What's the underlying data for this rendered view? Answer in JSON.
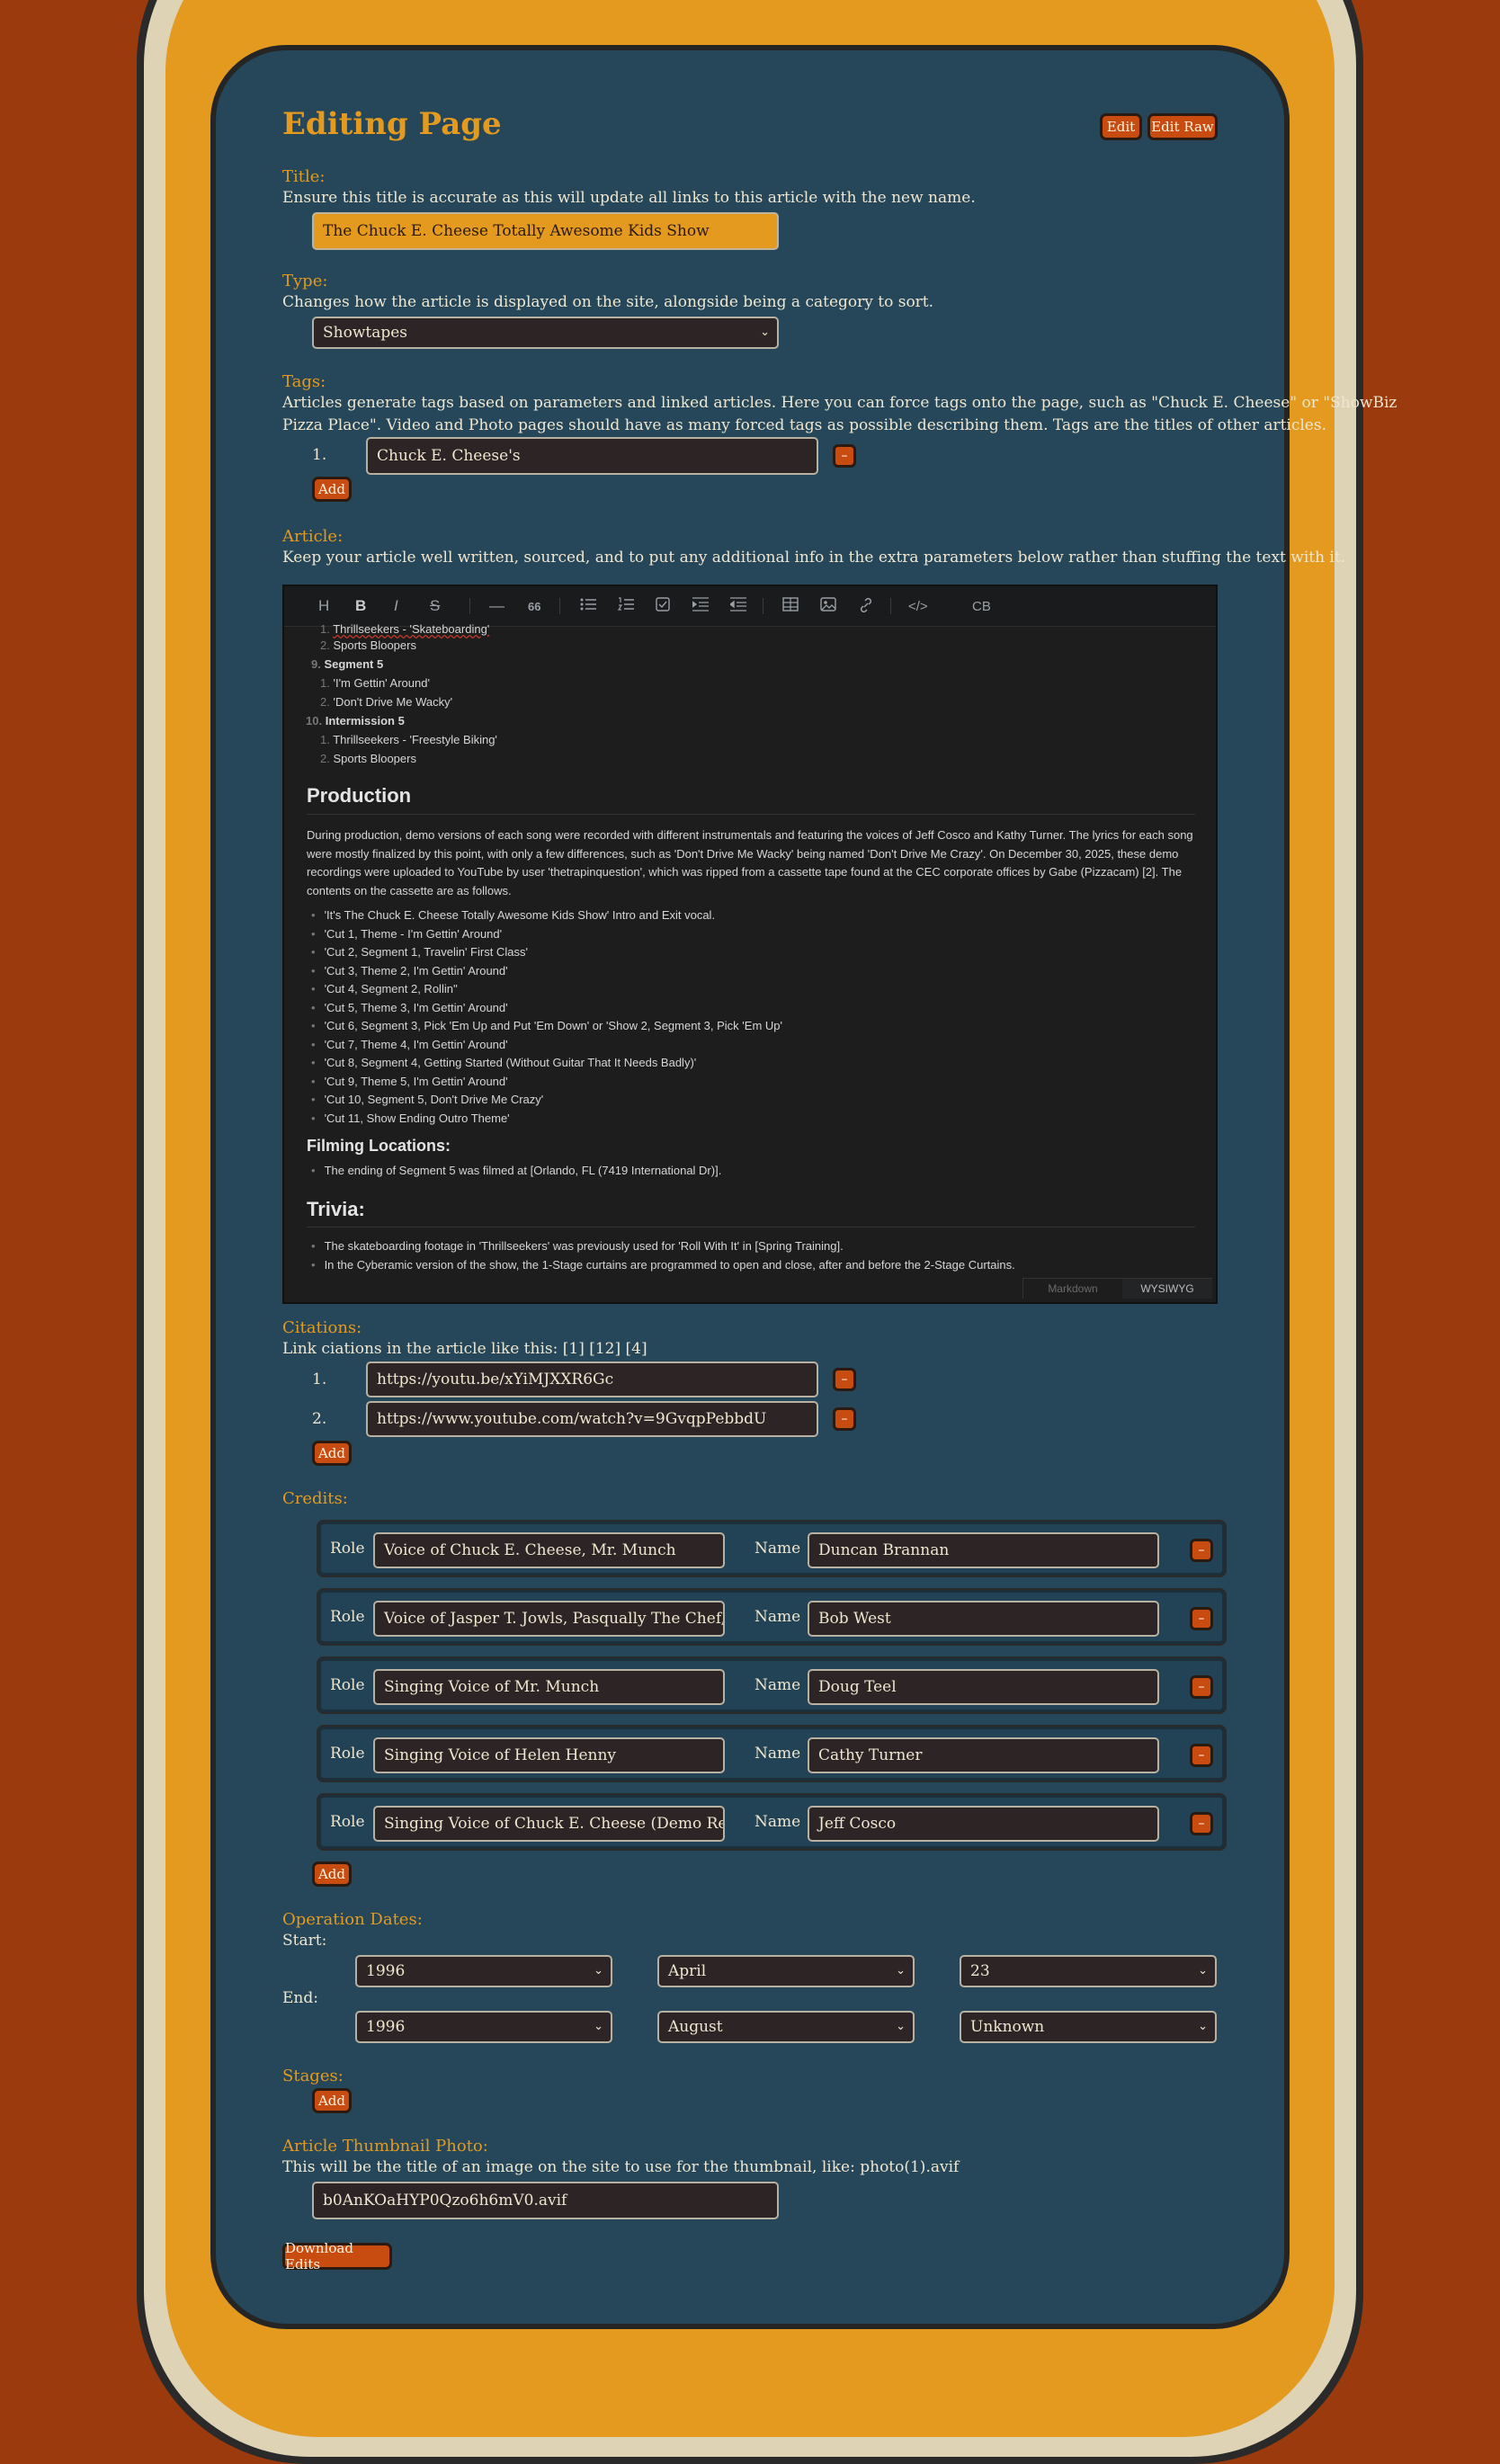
{
  "page": {
    "title": "Editing Page",
    "edit_label": "Edit",
    "edit_raw_label": "Edit Raw"
  },
  "title_field": {
    "label": "Title:",
    "description": "Ensure this title is accurate as this will update all links to this article with the new name.",
    "value": "The Chuck E. Cheese Totally Awesome Kids Show"
  },
  "type_field": {
    "label": "Type:",
    "description": "Changes how the article is displayed on the site, alongside being a category to sort.",
    "value": "Showtapes"
  },
  "tags": {
    "label": "Tags:",
    "description_1": "Articles generate tags based on parameters and linked articles. Here you can force tags onto the page, such as \"Chuck E. Cheese\" or \"ShowBiz",
    "description_2": "Pizza Place\". Video and Photo pages should have as many forced tags as possible describing them. Tags are the titles of other articles.",
    "items": [
      {
        "num": "1.",
        "value": "Chuck E. Cheese's"
      }
    ],
    "add_label": "Add",
    "remove_label": "–"
  },
  "article": {
    "label": "Article:",
    "description": "Keep your article well written, sourced, and to put any additional info in the extra parameters below rather than stuffing the text with it.",
    "toolbar": [
      "heading-icon",
      "bold-icon",
      "italic-icon",
      "strike-icon",
      "hr-icon",
      "quote-icon",
      "bullet-list-icon",
      "ordered-list-icon",
      "task-icon",
      "indent-icon",
      "outdent-icon",
      "table-icon",
      "image-icon",
      "link-icon",
      "code-icon",
      "codeblock-icon"
    ],
    "toolbar_glyphs": {
      "heading": "H",
      "bold": "B",
      "italic": "I",
      "strike": "S",
      "hr": "—",
      "quote": "66",
      "code": "</>",
      "codeblock": "CB"
    },
    "outline": [
      {
        "n": "1.",
        "text": "Thrillseekers - 'Skateboarding'"
      },
      {
        "n": "2.",
        "text": "Sports Bloopers"
      },
      {
        "n": "9.",
        "text": "Segment 5"
      },
      {
        "n": "1.",
        "text": "'I'm Gettin' Around'"
      },
      {
        "n": "2.",
        "text": "'Don't Drive Me Wacky'"
      },
      {
        "n": "10.",
        "text": "Intermission 5"
      },
      {
        "n": "1.",
        "text": "Thrillseekers - 'Freestyle Biking'"
      },
      {
        "n": "2.",
        "text": "Sports Bloopers"
      }
    ],
    "production_heading": "Production",
    "production_para_1": "During production, demo versions of each song were recorded with different instrumentals and featuring the voices of Jeff Cosco and Kathy Turner. The lyrics for each song",
    "production_para_2": "were mostly finalized by this point, with only a few differences, such as 'Don't Drive Me Wacky' being named 'Don't Drive Me Crazy'. On December 30, 2025, these demo",
    "production_para_3": "recordings were uploaded to YouTube by user 'thetrapinquestion', which was ripped from a cassette tape found at the CEC corporate offices by Gabe (Pizzacam) [2]. The",
    "production_para_4": "contents on the cassette are as follows.",
    "cassette": [
      "'It's The Chuck E. Cheese Totally Awesome Kids Show' Intro and Exit vocal.",
      "'Cut 1, Theme - I'm Gettin' Around'",
      "'Cut 2, Segment 1, Travelin' First Class'",
      "'Cut 3, Theme 2, I'm Gettin' Around'",
      "'Cut 4, Segment 2, Rollin''",
      "'Cut 5, Theme 3, I'm Gettin' Around'",
      "'Cut 6, Segment 3, Pick 'Em Up and Put 'Em Down' or 'Show 2, Segment 3, Pick 'Em Up'",
      "'Cut 7, Theme 4, I'm Gettin' Around'",
      "'Cut 8, Segment 4, Getting Started (Without Guitar That It Needs Badly)'",
      "'Cut 9, Theme 5, I'm Gettin' Around'",
      "'Cut 10, Segment 5, Don't Drive Me Crazy'",
      "'Cut 11, Show Ending Outro Theme'"
    ],
    "filming_heading": "Filming Locations:",
    "filming_item": "The ending of Segment 5 was filmed at [Orlando, FL (7419 International Dr)].",
    "trivia_heading": "Trivia:",
    "trivia_items": [
      "The skateboarding footage in 'Thrillseekers' was previously used for 'Roll With It' in [Spring Training].",
      "In the Cyberamic version of the show, the 1-Stage curtains are programmed to open and close, after and before the 2-Stage Curtains."
    ],
    "tab_markdown": "Markdown",
    "tab_wysiwyg": "WYSIWYG"
  },
  "citations": {
    "label": "Citations:",
    "description": "Link ciations in the article like this: [1] [12] [4]",
    "items": [
      {
        "num": "1.",
        "value": "https://youtu.be/xYiMJXXR6Gc"
      },
      {
        "num": "2.",
        "value": "https://www.youtube.com/watch?v=9GvqpPebbdU"
      }
    ],
    "add_label": "Add"
  },
  "credits": {
    "label": "Credits:",
    "role_label": "Role",
    "name_label": "Name",
    "items": [
      {
        "role": "Voice of Chuck E. Cheese, Mr. Munch",
        "name": "Duncan Brannan"
      },
      {
        "role": "Voice of Jasper T. Jowls, Pasqually The Chef, Mr. Mu",
        "name": "Bob West"
      },
      {
        "role": "Singing Voice of Mr. Munch",
        "name": "Doug Teel"
      },
      {
        "role": "Singing Voice of Helen Henny",
        "name": "Cathy Turner"
      },
      {
        "role": "Singing Voice of Chuck E. Cheese (Demo Recordings",
        "name": "Jeff Cosco"
      }
    ],
    "add_label": "Add"
  },
  "dates": {
    "label": "Operation Dates:",
    "start_label": "Start:",
    "end_label": "End:",
    "start": {
      "year": "1996",
      "month": "April",
      "day": "23"
    },
    "end": {
      "year": "1996",
      "month": "August",
      "day": "Unknown"
    }
  },
  "stages": {
    "label": "Stages:",
    "add_label": "Add"
  },
  "thumbnail": {
    "label": "Article Thumbnail Photo:",
    "description": "This will be the title of an image on the site to use for the thumbnail, like: photo(1).avif",
    "value": "b0AnKOaHYP0Qzo6h6mV0.avif"
  },
  "download_label": "Download Edits",
  "colors": {
    "background": "#9b3a0c",
    "ring": "#e39a1f",
    "panel": "#254759",
    "accent": "#e39a1f",
    "button": "#c84b10"
  }
}
